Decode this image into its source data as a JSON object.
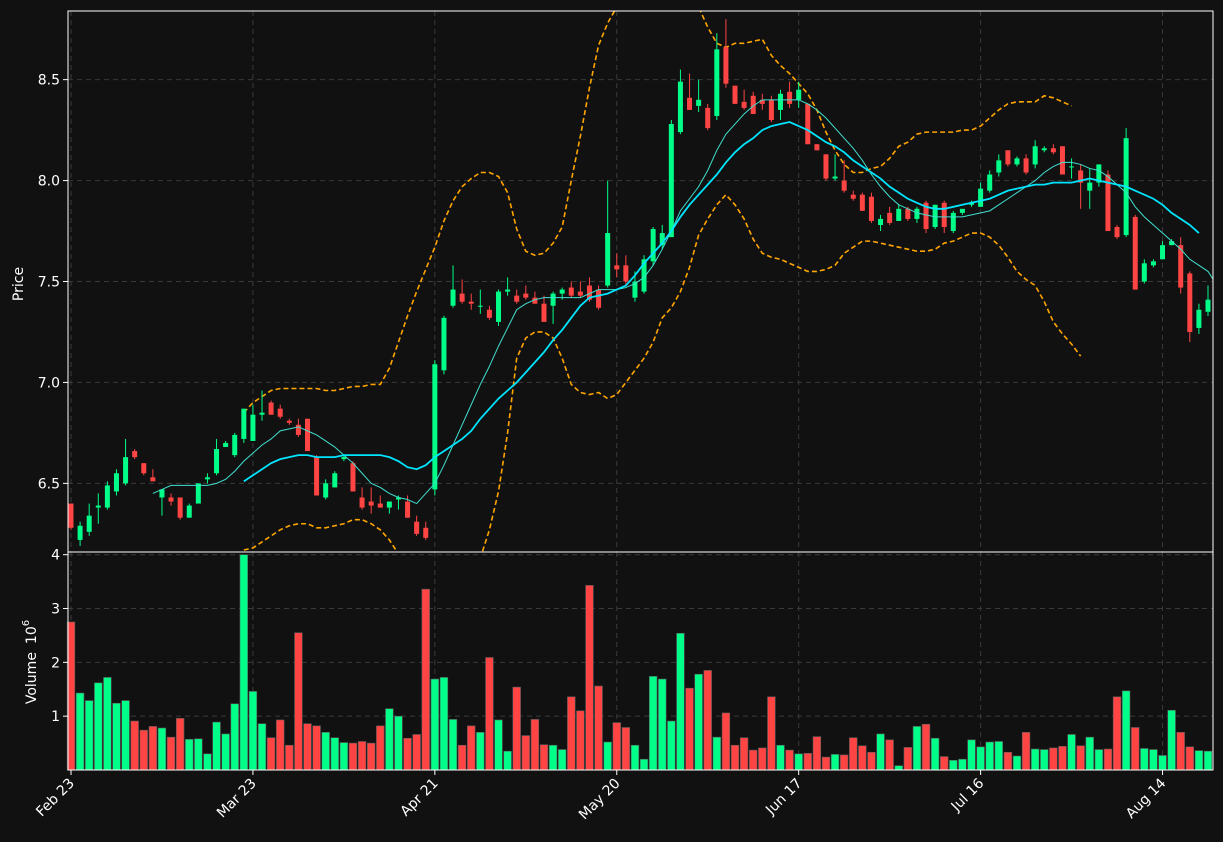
{
  "chart_data": {
    "type": "candlestick",
    "colors": {
      "background": "#111111",
      "up": "#00ff88",
      "down": "#ff4444",
      "ma_short": "#40e0d0",
      "ma_long": "#00e5ff",
      "bands": "#ffa500",
      "grid": "#3a3a3a",
      "axis": "#ffffff"
    },
    "price_panel": {
      "ylabel": "Price",
      "ylim": [
        6.16,
        8.84
      ],
      "yticks": [
        6.5,
        7.0,
        7.5,
        8.0,
        8.5
      ]
    },
    "volume_panel": {
      "ylabel": "Volume",
      "unit": "10^6",
      "ylim": [
        0,
        4.05
      ],
      "yticks": [
        1,
        2,
        3,
        4
      ]
    },
    "x_ticks": [
      {
        "index": 0,
        "label": "Feb 23"
      },
      {
        "index": 20,
        "label": "Mar 23"
      },
      {
        "index": 40,
        "label": "Apr 21"
      },
      {
        "index": 60,
        "label": "May 20"
      },
      {
        "index": 80,
        "label": "Jun 17"
      },
      {
        "index": 100,
        "label": "Jul 16"
      },
      {
        "index": 120,
        "label": "Aug 14"
      }
    ],
    "ohlc": [
      [
        6.4,
        6.4,
        6.27,
        6.28
      ],
      [
        6.22,
        6.31,
        6.19,
        6.29
      ],
      [
        6.26,
        6.4,
        6.24,
        6.34
      ],
      [
        6.38,
        6.45,
        6.3,
        6.39
      ],
      [
        6.38,
        6.51,
        6.37,
        6.49
      ],
      [
        6.46,
        6.57,
        6.44,
        6.55
      ],
      [
        6.5,
        6.72,
        6.49,
        6.63
      ],
      [
        6.66,
        6.67,
        6.62,
        6.63
      ],
      [
        6.6,
        6.6,
        6.54,
        6.55
      ],
      [
        6.53,
        6.57,
        6.51,
        6.51
      ],
      [
        6.43,
        6.47,
        6.34,
        6.47
      ],
      [
        6.43,
        6.45,
        6.39,
        6.41
      ],
      [
        6.43,
        6.43,
        6.32,
        6.33
      ],
      [
        6.33,
        6.4,
        6.33,
        6.39
      ],
      [
        6.4,
        6.48,
        6.4,
        6.5
      ],
      [
        6.52,
        6.55,
        6.5,
        6.53
      ],
      [
        6.55,
        6.72,
        6.54,
        6.67
      ],
      [
        6.68,
        6.71,
        6.68,
        6.7
      ],
      [
        6.64,
        6.75,
        6.63,
        6.74
      ],
      [
        6.72,
        6.86,
        6.7,
        6.87
      ],
      [
        6.71,
        6.89,
        6.71,
        6.84
      ],
      [
        6.84,
        6.96,
        6.81,
        6.85
      ],
      [
        6.9,
        6.91,
        6.84,
        6.84
      ],
      [
        6.87,
        6.89,
        6.82,
        6.83
      ],
      [
        6.81,
        6.82,
        6.79,
        6.8
      ],
      [
        6.79,
        6.82,
        6.73,
        6.74
      ],
      [
        6.82,
        6.82,
        6.67,
        6.66
      ],
      [
        6.63,
        6.64,
        6.44,
        6.44
      ],
      [
        6.43,
        6.52,
        6.42,
        6.5
      ],
      [
        6.48,
        6.56,
        6.48,
        6.55
      ],
      [
        6.62,
        6.64,
        6.61,
        6.63
      ],
      [
        6.6,
        6.61,
        6.46,
        6.46
      ],
      [
        6.43,
        6.48,
        6.37,
        6.38
      ],
      [
        6.41,
        6.48,
        6.35,
        6.39
      ],
      [
        6.4,
        6.44,
        6.38,
        6.38
      ],
      [
        6.38,
        6.41,
        6.35,
        6.41
      ],
      [
        6.42,
        6.44,
        6.37,
        6.43
      ],
      [
        6.41,
        6.44,
        6.33,
        6.33
      ],
      [
        6.31,
        6.34,
        6.24,
        6.25
      ],
      [
        6.28,
        6.31,
        6.22,
        6.23
      ],
      [
        6.47,
        7.11,
        6.44,
        7.09
      ],
      [
        7.06,
        7.33,
        7.04,
        7.32
      ],
      [
        7.38,
        7.58,
        7.37,
        7.46
      ],
      [
        7.44,
        7.51,
        7.39,
        7.4
      ],
      [
        7.4,
        7.44,
        7.36,
        7.39
      ],
      [
        7.38,
        7.46,
        7.34,
        7.38
      ],
      [
        7.36,
        7.38,
        7.31,
        7.32
      ],
      [
        7.3,
        7.46,
        7.28,
        7.45
      ],
      [
        7.45,
        7.52,
        7.43,
        7.46
      ],
      [
        7.43,
        7.46,
        7.39,
        7.4
      ],
      [
        7.44,
        7.48,
        7.41,
        7.42
      ],
      [
        7.42,
        7.45,
        7.39,
        7.39
      ],
      [
        7.39,
        7.43,
        7.3,
        7.3
      ],
      [
        7.38,
        7.45,
        7.29,
        7.44
      ],
      [
        7.44,
        7.47,
        7.41,
        7.46
      ],
      [
        7.47,
        7.5,
        7.42,
        7.43
      ],
      [
        7.45,
        7.5,
        7.42,
        7.43
      ],
      [
        7.48,
        7.52,
        7.4,
        7.41
      ],
      [
        7.46,
        7.48,
        7.36,
        7.37
      ],
      [
        7.48,
        8.0,
        7.47,
        7.74
      ],
      [
        7.58,
        7.64,
        7.52,
        7.56
      ],
      [
        7.58,
        7.63,
        7.48,
        7.5
      ],
      [
        7.42,
        7.55,
        7.4,
        7.5
      ],
      [
        7.45,
        7.63,
        7.44,
        7.61
      ],
      [
        7.6,
        7.77,
        7.58,
        7.76
      ],
      [
        7.68,
        7.78,
        7.66,
        7.74
      ],
      [
        7.72,
        8.3,
        7.72,
        8.28
      ],
      [
        8.24,
        8.55,
        8.23,
        8.49
      ],
      [
        8.41,
        8.53,
        8.35,
        8.35
      ],
      [
        8.37,
        8.5,
        8.34,
        8.4
      ],
      [
        8.36,
        8.38,
        8.25,
        8.26
      ],
      [
        8.32,
        8.73,
        8.3,
        8.65
      ],
      [
        8.66,
        8.8,
        8.46,
        8.48
      ],
      [
        8.47,
        8.47,
        8.38,
        8.38
      ],
      [
        8.39,
        8.45,
        8.35,
        8.36
      ],
      [
        8.42,
        8.44,
        8.33,
        8.33
      ],
      [
        8.4,
        8.43,
        8.35,
        8.38
      ],
      [
        8.4,
        8.42,
        8.29,
        8.3
      ],
      [
        8.35,
        8.45,
        8.3,
        8.43
      ],
      [
        8.44,
        8.49,
        8.36,
        8.38
      ],
      [
        8.4,
        8.49,
        8.36,
        8.45
      ],
      [
        8.38,
        8.38,
        8.18,
        8.18
      ],
      [
        8.18,
        8.18,
        8.15,
        8.15
      ],
      [
        8.13,
        8.13,
        8.0,
        8.01
      ],
      [
        8.01,
        8.13,
        8.0,
        8.02
      ],
      [
        8.0,
        8.1,
        7.94,
        7.95
      ],
      [
        7.93,
        7.95,
        7.9,
        7.91
      ],
      [
        7.93,
        7.94,
        7.85,
        7.85
      ],
      [
        7.92,
        7.94,
        7.79,
        7.8
      ],
      [
        7.78,
        7.83,
        7.75,
        7.81
      ],
      [
        7.84,
        7.87,
        7.78,
        7.79
      ],
      [
        7.8,
        7.88,
        7.8,
        7.86
      ],
      [
        7.86,
        7.87,
        7.8,
        7.81
      ],
      [
        7.81,
        7.87,
        7.79,
        7.86
      ],
      [
        7.89,
        7.9,
        7.74,
        7.76
      ],
      [
        7.77,
        7.88,
        7.76,
        7.88
      ],
      [
        7.89,
        7.9,
        7.74,
        7.77
      ],
      [
        7.75,
        7.85,
        7.74,
        7.84
      ],
      [
        7.84,
        7.85,
        7.83,
        7.86
      ],
      [
        7.88,
        7.9,
        7.87,
        7.89
      ],
      [
        7.87,
        7.99,
        7.87,
        7.96
      ],
      [
        7.95,
        8.05,
        7.94,
        8.03
      ],
      [
        8.04,
        8.13,
        8.02,
        8.1
      ],
      [
        8.15,
        8.15,
        8.07,
        8.08
      ],
      [
        8.08,
        8.12,
        8.07,
        8.11
      ],
      [
        8.11,
        8.13,
        8.03,
        8.04
      ],
      [
        8.08,
        8.2,
        8.06,
        8.17
      ],
      [
        8.15,
        8.17,
        8.14,
        8.16
      ],
      [
        8.16,
        8.18,
        8.13,
        8.14
      ],
      [
        8.17,
        8.17,
        8.03,
        8.03
      ],
      [
        8.07,
        8.11,
        8.01,
        8.07
      ],
      [
        8.05,
        8.08,
        7.86,
        7.99
      ],
      [
        7.95,
        8.06,
        7.86,
        7.99
      ],
      [
        7.99,
        8.08,
        7.97,
        8.08
      ],
      [
        8.03,
        8.05,
        7.76,
        7.75
      ],
      [
        7.77,
        7.78,
        7.71,
        7.72
      ],
      [
        7.73,
        8.26,
        7.72,
        8.21
      ],
      [
        7.82,
        7.83,
        7.46,
        7.46
      ],
      [
        7.5,
        7.61,
        7.49,
        7.59
      ],
      [
        7.58,
        7.61,
        7.57,
        7.6
      ],
      [
        7.61,
        7.7,
        7.61,
        7.68
      ],
      [
        7.68,
        7.71,
        7.68,
        7.7
      ],
      [
        7.68,
        7.72,
        7.44,
        7.47
      ],
      [
        7.54,
        7.55,
        7.2,
        7.25
      ],
      [
        7.27,
        7.39,
        7.24,
        7.36
      ],
      [
        7.35,
        7.48,
        7.33,
        7.41
      ],
      [
        7.4,
        7.41,
        7.22,
        7.23
      ]
    ],
    "volume": [
      2.75,
      1.43,
      1.29,
      1.62,
      1.72,
      1.24,
      1.29,
      0.91,
      0.74,
      0.81,
      0.78,
      0.61,
      0.96,
      0.57,
      0.58,
      0.3,
      0.89,
      0.67,
      1.23,
      4.0,
      1.46,
      0.86,
      0.6,
      0.93,
      0.46,
      2.55,
      0.86,
      0.82,
      0.7,
      0.6,
      0.51,
      0.5,
      0.53,
      0.5,
      0.82,
      1.14,
      1.0,
      0.59,
      0.66,
      3.36,
      1.69,
      1.72,
      0.94,
      0.46,
      0.82,
      0.7,
      2.09,
      0.93,
      0.35,
      1.54,
      0.64,
      0.94,
      0.47,
      0.46,
      0.38,
      1.36,
      1.1,
      3.43,
      1.56,
      0.52,
      0.88,
      0.79,
      0.46,
      0.2,
      1.74,
      1.69,
      0.91,
      2.54,
      1.52,
      1.78,
      1.85,
      0.61,
      1.06,
      0.46,
      0.6,
      0.37,
      0.41,
      1.36,
      0.46,
      0.37,
      0.3,
      0.31,
      0.62,
      0.24,
      0.29,
      0.28,
      0.6,
      0.45,
      0.33,
      0.67,
      0.56,
      0.08,
      0.42,
      0.81,
      0.85,
      0.59,
      0.25,
      0.18,
      0.2,
      0.56,
      0.43,
      0.52,
      0.53,
      0.33,
      0.26,
      0.7,
      0.39,
      0.38,
      0.41,
      0.44,
      0.66,
      0.45,
      0.61,
      0.38,
      0.39,
      1.36,
      1.47,
      0.79,
      0.4,
      0.38,
      0.27,
      1.11,
      0.7,
      0.43,
      0.36,
      0.35
    ],
    "ma_short": [
      null,
      null,
      null,
      null,
      null,
      null,
      null,
      null,
      null,
      6.45,
      6.47,
      6.49,
      6.49,
      6.49,
      6.49,
      6.49,
      6.5,
      6.52,
      6.56,
      6.61,
      6.65,
      6.69,
      6.72,
      6.76,
      6.77,
      6.78,
      6.76,
      6.74,
      6.71,
      6.68,
      6.64,
      6.6,
      6.55,
      6.5,
      6.48,
      6.45,
      6.43,
      6.42,
      6.4,
      6.45,
      6.5,
      6.59,
      6.69,
      6.79,
      6.89,
      6.99,
      7.08,
      7.18,
      7.27,
      7.36,
      7.39,
      7.41,
      7.42,
      7.42,
      7.42,
      7.42,
      7.42,
      7.44,
      7.46,
      7.46,
      7.46,
      7.47,
      7.49,
      7.52,
      7.58,
      7.66,
      7.75,
      7.85,
      7.91,
      7.97,
      8.05,
      8.15,
      8.23,
      8.28,
      8.33,
      8.37,
      8.4,
      8.4,
      8.4,
      8.4,
      8.4,
      8.38,
      8.35,
      8.31,
      8.26,
      8.21,
      8.16,
      8.1,
      8.03,
      7.97,
      7.92,
      7.88,
      7.86,
      7.84,
      7.83,
      7.82,
      7.82,
      7.82,
      7.82,
      7.83,
      7.84,
      7.85,
      7.88,
      7.91,
      7.94,
      7.97,
      8.0,
      8.04,
      8.07,
      8.09,
      8.09,
      8.08,
      8.06,
      8.05,
      8.02,
      7.98,
      7.94,
      7.87,
      7.82,
      7.78,
      7.74,
      7.7,
      7.66,
      7.61,
      7.58,
      7.55,
      7.48
    ],
    "ma_long": [
      null,
      null,
      null,
      null,
      null,
      null,
      null,
      null,
      null,
      null,
      null,
      null,
      null,
      null,
      null,
      null,
      null,
      null,
      null,
      6.51,
      6.54,
      6.57,
      6.6,
      6.62,
      6.63,
      6.64,
      6.64,
      6.63,
      6.63,
      6.63,
      6.64,
      6.64,
      6.64,
      6.64,
      6.64,
      6.63,
      6.61,
      6.58,
      6.57,
      6.59,
      6.63,
      6.66,
      6.69,
      6.72,
      6.76,
      6.82,
      6.87,
      6.92,
      6.96,
      7.0,
      7.05,
      7.1,
      7.15,
      7.21,
      7.26,
      7.32,
      7.38,
      7.42,
      7.43,
      7.44,
      7.46,
      7.48,
      7.53,
      7.59,
      7.64,
      7.69,
      7.75,
      7.82,
      7.88,
      7.93,
      7.98,
      8.03,
      8.09,
      8.14,
      8.18,
      8.21,
      8.25,
      8.27,
      8.28,
      8.29,
      8.27,
      8.25,
      8.22,
      8.19,
      8.17,
      8.14,
      8.1,
      8.07,
      8.04,
      8.01,
      7.97,
      7.94,
      7.91,
      7.89,
      7.87,
      7.86,
      7.86,
      7.87,
      7.88,
      7.89,
      7.9,
      7.91,
      7.93,
      7.95,
      7.96,
      7.97,
      7.98,
      7.98,
      7.99,
      7.99,
      7.99,
      8.0,
      8.01,
      8.0,
      7.99,
      7.98,
      7.97,
      7.95,
      7.93,
      7.91,
      7.88,
      7.84,
      7.81,
      7.78,
      7.74
    ],
    "bb_upper": [
      null,
      null,
      null,
      null,
      null,
      null,
      null,
      null,
      null,
      null,
      null,
      null,
      null,
      null,
      null,
      null,
      null,
      null,
      null,
      6.85,
      6.9,
      6.93,
      6.96,
      6.97,
      6.97,
      6.97,
      6.97,
      6.97,
      6.96,
      6.96,
      6.97,
      6.98,
      6.98,
      6.99,
      6.99,
      7.07,
      7.2,
      7.33,
      7.45,
      7.56,
      7.67,
      7.8,
      7.9,
      7.97,
      8.01,
      8.04,
      8.04,
      8.02,
      7.94,
      7.76,
      7.65,
      7.63,
      7.64,
      7.69,
      7.77,
      8.0,
      8.22,
      8.46,
      8.67,
      8.78,
      8.86,
      8.97,
      9.05,
      9.1,
      9.12,
      9.15,
      9.14,
      9.08,
      8.98,
      8.86,
      8.76,
      8.68,
      8.66,
      8.68,
      8.68,
      8.69,
      8.7,
      8.62,
      8.57,
      8.53,
      8.48,
      8.43,
      8.35,
      8.24,
      8.15,
      8.08,
      8.04,
      8.04,
      8.06,
      8.07,
      8.11,
      8.17,
      8.19,
      8.23,
      8.24,
      8.24,
      8.24,
      8.24,
      8.25,
      8.25,
      8.27,
      8.31,
      8.35,
      8.38,
      8.39,
      8.39,
      8.39,
      8.42,
      8.41,
      8.39,
      8.37
    ],
    "bb_lower": [
      null,
      null,
      null,
      null,
      null,
      null,
      null,
      null,
      null,
      null,
      null,
      null,
      null,
      null,
      null,
      null,
      null,
      null,
      null,
      6.17,
      6.18,
      6.21,
      6.24,
      6.27,
      6.29,
      6.3,
      6.3,
      6.28,
      6.28,
      6.29,
      6.3,
      6.32,
      6.32,
      6.3,
      6.27,
      6.22,
      6.15,
      6.06,
      5.96,
      5.88,
      5.81,
      5.84,
      5.88,
      5.95,
      6.04,
      6.13,
      6.27,
      6.46,
      6.75,
      7.12,
      7.22,
      7.25,
      7.25,
      7.22,
      7.12,
      6.99,
      6.95,
      6.94,
      6.95,
      6.92,
      6.94,
      7.0,
      7.06,
      7.12,
      7.2,
      7.32,
      7.37,
      7.45,
      7.57,
      7.73,
      7.81,
      7.88,
      7.93,
      7.88,
      7.81,
      7.71,
      7.64,
      7.62,
      7.61,
      7.59,
      7.57,
      7.55,
      7.55,
      7.56,
      7.58,
      7.64,
      7.67,
      7.7,
      7.7,
      7.69,
      7.68,
      7.67,
      7.66,
      7.65,
      7.65,
      7.66,
      7.69,
      7.7,
      7.72,
      7.74,
      7.74,
      7.72,
      7.68,
      7.62,
      7.55,
      7.51,
      7.48,
      7.4,
      7.3,
      7.24,
      7.19,
      7.13
    ]
  }
}
